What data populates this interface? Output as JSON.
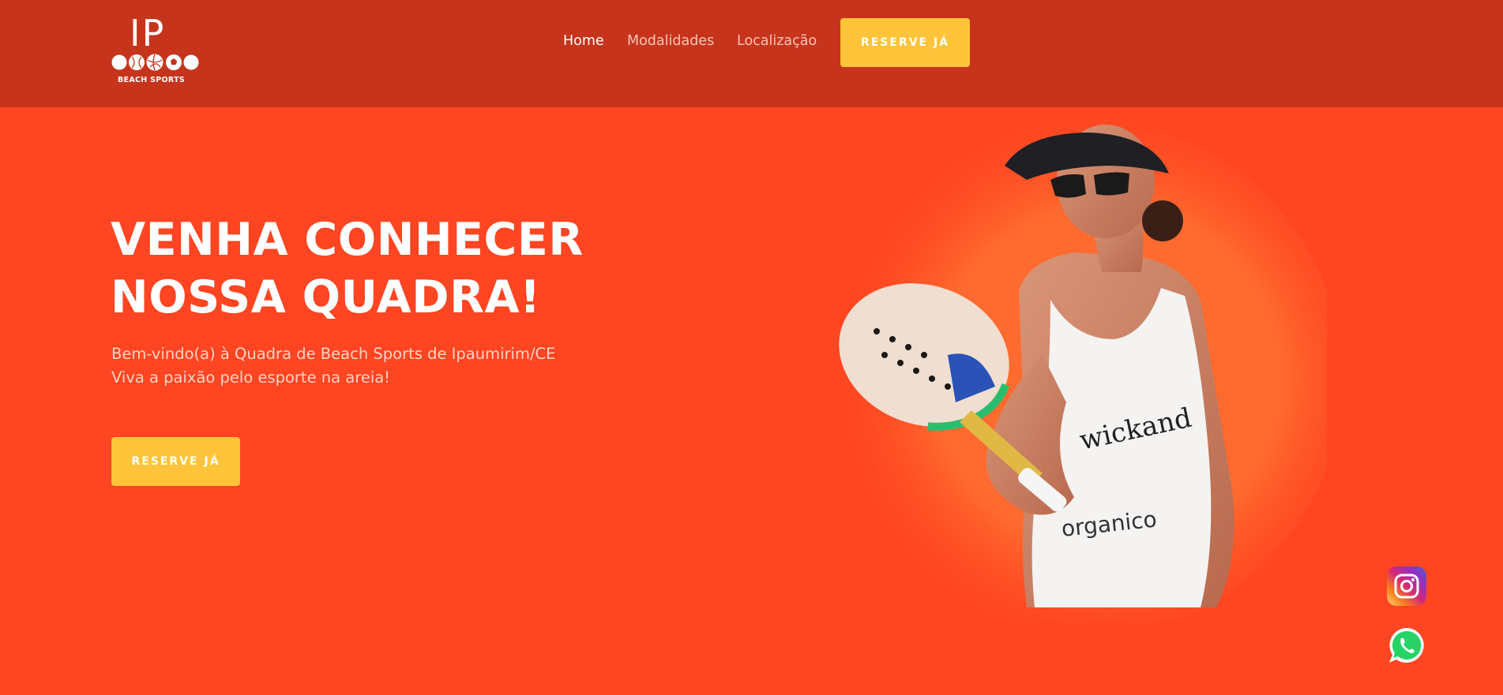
{
  "header": {
    "logo": {
      "mark": "IP",
      "subtitle": "BEACH SPORTS",
      "icon": "sports-balls-logo-icon"
    },
    "nav": [
      {
        "label": "Home",
        "active": true
      },
      {
        "label": "Modalidades",
        "active": false
      },
      {
        "label": "Localização",
        "active": false
      }
    ],
    "cta_label": "RESERVE JÁ"
  },
  "hero": {
    "title_line1": "VENHA CONHECER",
    "title_line2": "NOSSA QUADRA!",
    "subtitle_line1": "Bem-vindo(a) à Quadra de Beach Sports de Ipaumirim/CE",
    "subtitle_line2": "Viva a paixão pelo esporte na areia!",
    "cta_label": "RESERVE JÁ",
    "image": {
      "description_icon": "beach-tennis-player-photo"
    }
  },
  "floating": {
    "instagram_icon": "instagram-icon",
    "whatsapp_icon": "whatsapp-icon"
  },
  "colors": {
    "header_bg": "#c7341c",
    "hero_bg": "#ff4521",
    "accent": "#ffc43a",
    "text": "#ffffff"
  }
}
